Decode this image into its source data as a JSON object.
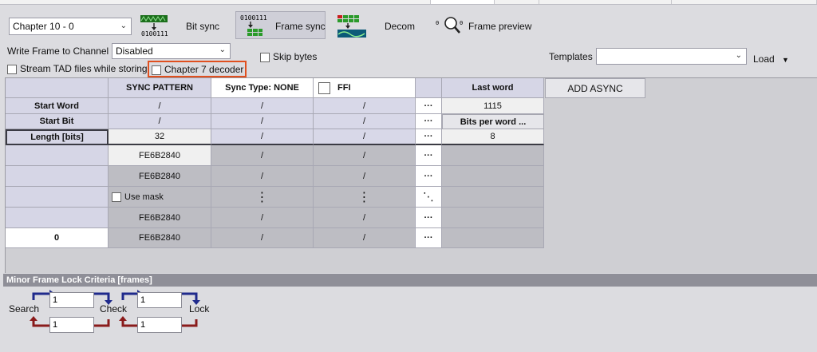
{
  "toolbar": {
    "chapter_select": "Chapter 10 - 0",
    "bit_sync_label": "Bit sync",
    "frame_sync_label": "Frame sync",
    "decom_label": "Decom",
    "frame_preview_label": "Frame preview"
  },
  "options": {
    "write_frame_label": "Write Frame to Channel",
    "write_frame_value": "Disabled",
    "stream_tad_label": "Stream TAD files while storing",
    "chapter7_label": "Chapter 7 decoder",
    "skip_bytes_label": "Skip bytes",
    "templates_label": "Templates",
    "templates_value": "",
    "load_label": "Load"
  },
  "grid": {
    "headers": {
      "sync_pattern": "SYNC PATTERN",
      "sync_type": "Sync Type: NONE",
      "ffi": "FFI",
      "last_word": "Last word",
      "add_async": "ADD ASYNC"
    },
    "row_labels": {
      "start_word": "Start Word",
      "start_bit": "Start Bit",
      "length": "Length [bits]"
    },
    "slash": "/",
    "ellipsis": "···",
    "vdots": "⋮",
    "ddots": "⋱",
    "length_value": "32",
    "last_word_value": "1115",
    "bits_per_word_label": "Bits per word ...",
    "bits_per_word_value": "8",
    "pattern_values": [
      "FE6B2840",
      "FE6B2840",
      "FE6B2840",
      "FE6B2840"
    ],
    "use_mask_label": "Use mask",
    "bottom_row_label": "0"
  },
  "lock_criteria": {
    "title": "Minor Frame Lock Criteria [frames]",
    "search_label": "Search",
    "check_label": "Check",
    "lock_label": "Lock",
    "search_to_check": "1",
    "check_to_search": "1",
    "check_to_lock": "1",
    "lock_to_check": "1"
  },
  "colors": {
    "highlight": "#e0501f",
    "forward_arrow": "#1f2a8c",
    "back_arrow": "#8a1b1b"
  }
}
